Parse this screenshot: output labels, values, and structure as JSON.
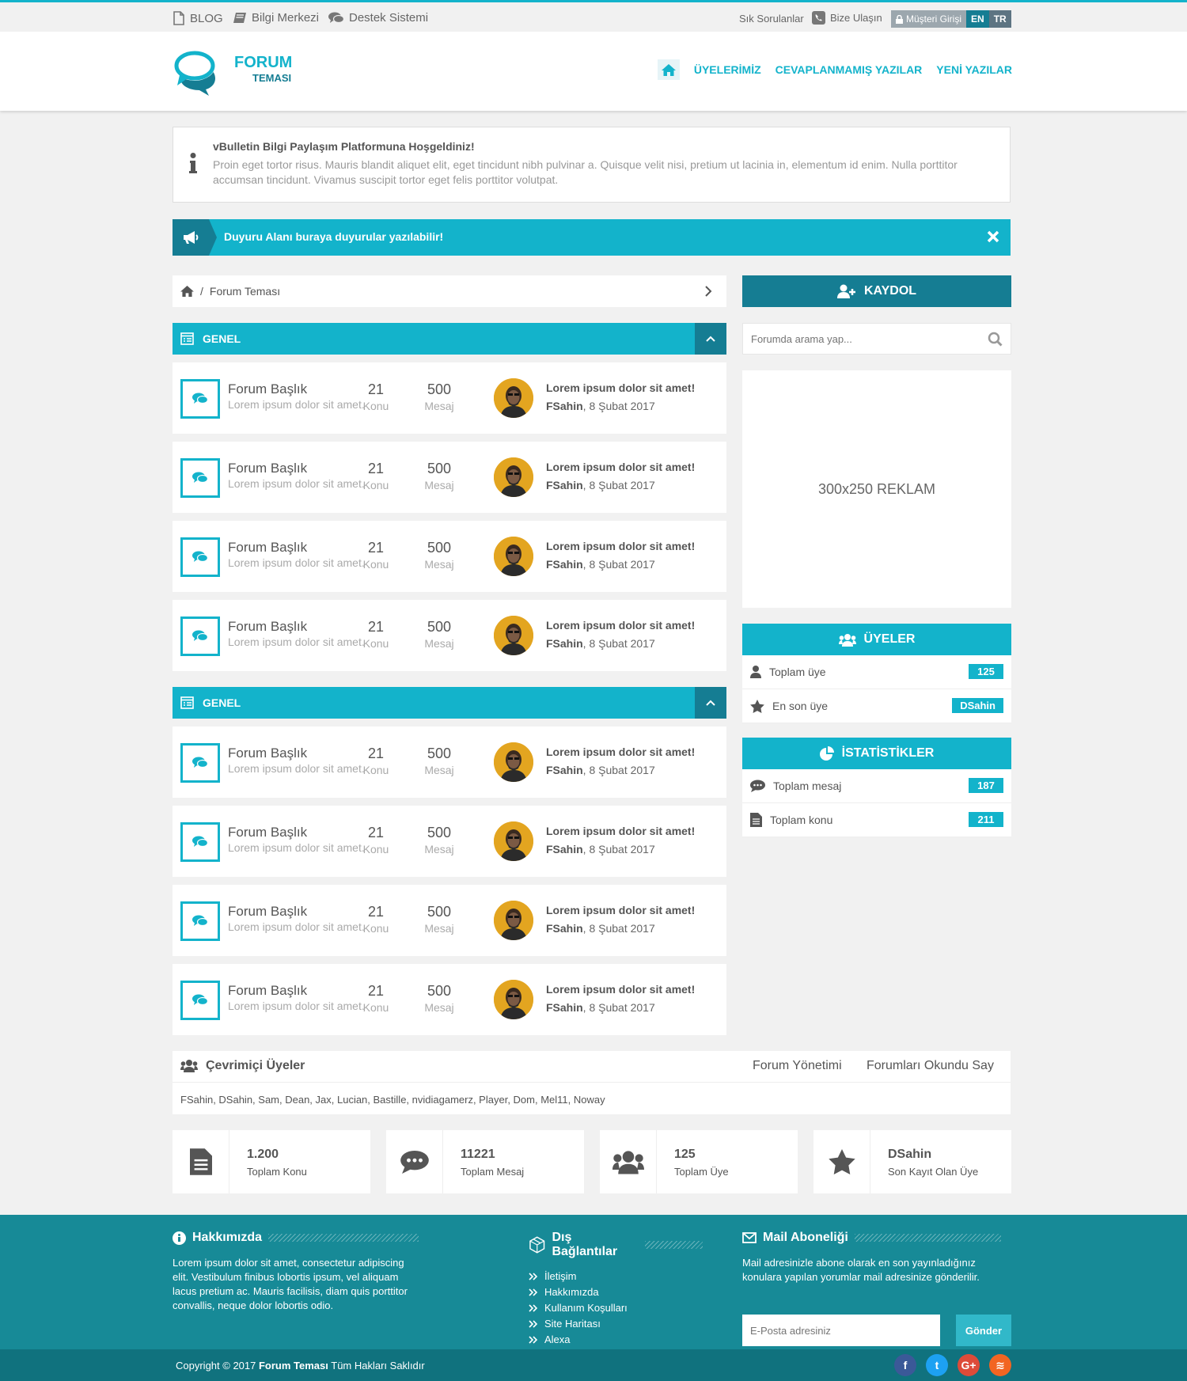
{
  "topbar": {
    "blog": "BLOG",
    "bilgi": "Bilgi Merkezi",
    "destek": "Destek Sistemi",
    "sss": "Sık Sorulanlar",
    "bize": "Bize Ulaşın",
    "musteri": "Müşteri Girişi",
    "langs": [
      "EN",
      "TR"
    ]
  },
  "header": {
    "logo_title": "FORUM",
    "logo_sub": "TEMASI",
    "nav": [
      "ÜYELERİMİZ",
      "CEVAPLANMAMIŞ YAZILAR",
      "YENİ YAZILAR"
    ]
  },
  "welcome": {
    "title": "vBulletin Bilgi Paylaşım Platformuna Hoşgeldiniz!",
    "text": "Proin eget tortor risus. Mauris blandit aliquet elit, eget tincidunt nibh pulvinar a. Quisque velit nisi, pretium ut lacinia in, elementum id enim. Nulla porttitor accumsan tincidunt. Vivamus suscipit tortor eget felis porttitor volutpat."
  },
  "announce": "Duyuru Alanı buraya duyurular yazılabilir!",
  "breadcrumb": {
    "sep": "/",
    "current": "Forum Teması"
  },
  "categories": [
    {
      "title": "GENEL",
      "forums": [
        {
          "title": "Forum Başlık",
          "desc": "Lorem ipsum dolor sit amet.",
          "topics": "21",
          "topics_label": "Konu",
          "posts": "500",
          "posts_label": "Mesaj",
          "last_post": "Lorem ipsum dolor sit amet!",
          "last_user": "FSahin",
          "last_date": ", 8 Şubat 2017"
        },
        {
          "title": "Forum Başlık",
          "desc": "Lorem ipsum dolor sit amet.",
          "topics": "21",
          "topics_label": "Konu",
          "posts": "500",
          "posts_label": "Mesaj",
          "last_post": "Lorem ipsum dolor sit amet!",
          "last_user": "FSahin",
          "last_date": ", 8 Şubat 2017"
        },
        {
          "title": "Forum Başlık",
          "desc": "Lorem ipsum dolor sit amet.",
          "topics": "21",
          "topics_label": "Konu",
          "posts": "500",
          "posts_label": "Mesaj",
          "last_post": "Lorem ipsum dolor sit amet!",
          "last_user": "FSahin",
          "last_date": ", 8 Şubat 2017"
        },
        {
          "title": "Forum Başlık",
          "desc": "Lorem ipsum dolor sit amet.",
          "topics": "21",
          "topics_label": "Konu",
          "posts": "500",
          "posts_label": "Mesaj",
          "last_post": "Lorem ipsum dolor sit amet!",
          "last_user": "FSahin",
          "last_date": ", 8 Şubat 2017"
        }
      ]
    },
    {
      "title": "GENEL",
      "forums": [
        {
          "title": "Forum Başlık",
          "desc": "Lorem ipsum dolor sit amet.",
          "topics": "21",
          "topics_label": "Konu",
          "posts": "500",
          "posts_label": "Mesaj",
          "last_post": "Lorem ipsum dolor sit amet!",
          "last_user": "FSahin",
          "last_date": ", 8 Şubat 2017"
        },
        {
          "title": "Forum Başlık",
          "desc": "Lorem ipsum dolor sit amet.",
          "topics": "21",
          "topics_label": "Konu",
          "posts": "500",
          "posts_label": "Mesaj",
          "last_post": "Lorem ipsum dolor sit amet!",
          "last_user": "FSahin",
          "last_date": ", 8 Şubat 2017"
        },
        {
          "title": "Forum Başlık",
          "desc": "Lorem ipsum dolor sit amet.",
          "topics": "21",
          "topics_label": "Konu",
          "posts": "500",
          "posts_label": "Mesaj",
          "last_post": "Lorem ipsum dolor sit amet!",
          "last_user": "FSahin",
          "last_date": ", 8 Şubat 2017"
        },
        {
          "title": "Forum Başlık",
          "desc": "Lorem ipsum dolor sit amet.",
          "topics": "21",
          "topics_label": "Konu",
          "posts": "500",
          "posts_label": "Mesaj",
          "last_post": "Lorem ipsum dolor sit amet!",
          "last_user": "FSahin",
          "last_date": ", 8 Şubat 2017"
        }
      ]
    }
  ],
  "sidebar": {
    "register": "KAYDOL",
    "search_placeholder": "Forumda arama yap...",
    "ad": "300x250 REKLAM",
    "members": {
      "title": "ÜYELER",
      "items": [
        {
          "label": "Toplam üye",
          "value": "125"
        },
        {
          "label": "En son üye",
          "value": "DSahin"
        }
      ]
    },
    "stats": {
      "title": "İSTATİSTİKLER",
      "items": [
        {
          "label": "Toplam mesaj",
          "value": "187"
        },
        {
          "label": "Toplam konu",
          "value": "211"
        }
      ]
    }
  },
  "online": {
    "title": "Çevrimiçi Üyeler",
    "link1": "Forum Yönetimi",
    "link2": "Forumları Okundu Say",
    "users": "FSahin, DSahin, Sam, Dean, Jax, Lucian, Bastille, nvidiagamerz, Player, Dom, Mel11, Noway"
  },
  "stat_cards": [
    {
      "value": "1.200",
      "label": "Toplam Konu",
      "icon": "file-icon"
    },
    {
      "value": "11221",
      "label": "Toplam Mesaj",
      "icon": "comment-icon"
    },
    {
      "value": "125",
      "label": "Toplam Üye",
      "icon": "users-icon"
    },
    {
      "value": "DSahin",
      "label": "Son Kayıt Olan Üye",
      "icon": "star-icon"
    }
  ],
  "footer": {
    "about_title": "Hakkımızda",
    "about_text": "Lorem ipsum dolor sit amet, consectetur adipiscing elit. Vestibulum finibus lobortis ipsum, vel aliquam lacus pretium ac. Mauris facilisis, diam quis porttitor convallis, neque dolor lobortis odio.",
    "links_title": "Dış Bağlantılar",
    "links": [
      "İletişim",
      "Hakkımızda",
      "Kullanım Koşulları",
      "Site Haritası",
      "Alexa"
    ],
    "mail_title": "Mail Aboneliği",
    "mail_text": "Mail adresinizle abone olarak en son yayınladığınız konulara yapılan yorumlar mail adresinize gönderilir.",
    "mail_placeholder": "E-Posta adresiniz",
    "mail_button": "Gönder",
    "copyright_pre": "Copyright © 2017 ",
    "copyright_brand": "Forum Teması",
    "copyright_post": " Tüm Hakları Saklıdır",
    "social": [
      {
        "name": "facebook",
        "glyph": "f",
        "color": "#3b5998"
      },
      {
        "name": "twitter",
        "glyph": "t",
        "color": "#1da1f2"
      },
      {
        "name": "google-plus",
        "glyph": "G+",
        "color": "#dd4b39"
      },
      {
        "name": "rss",
        "glyph": "≋",
        "color": "#f26522"
      }
    ]
  },
  "colors": {
    "accent": "#13b3cb",
    "dark_accent": "#157d93",
    "footer": "#178a97",
    "copyright_bar": "#10727e"
  }
}
